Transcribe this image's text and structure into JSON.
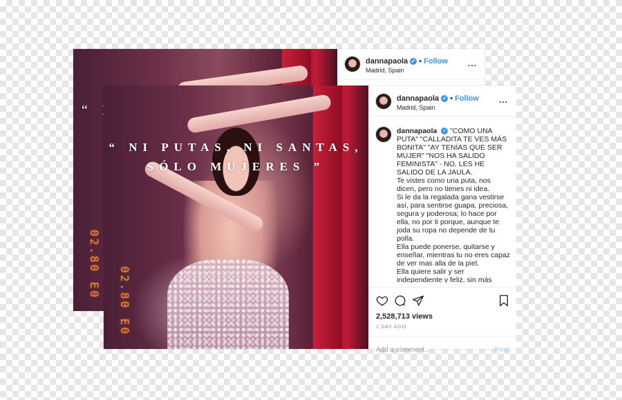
{
  "back_post": {
    "username": "dannapaola",
    "follow_label": "Follow",
    "separator": "•",
    "location": "Madrid, Spain",
    "more_label": "...",
    "overlay_quote_visible": "“ N",
    "datestamp": "02.80 E0"
  },
  "front_post": {
    "username": "dannapaola",
    "follow_label": "Follow",
    "separator": "•",
    "location": "Madrid, Spain",
    "more_label": "...",
    "overlay_quote_line1": "“ NI PUTAS, NI SANTAS,",
    "overlay_quote_line2": "SÓLO MUJERES ”",
    "datestamp": "02.80 E0",
    "caption_username": "dannapaola",
    "caption_lines": [
      "\"COMO UNA PUTA\" \"CALLADITA TE VES MÁS BONITA\" \"AY TENÍAS QUE SER MUJER\" \"NOS HA SALIDO FEMINISTA\" - NO, LES HE SALIDO DE LA JAULA.",
      "Te vistes como una puta, nos dicen, pero no tienes ni idea.",
      "Si le da la regalada gana vestirse así, para sentirse guapa, preciosa, segura y poderosa; lo hace por ella, no por ti porque, aunque te joda su ropa no depende de tu polla.",
      "Ella puede ponerse, quitarse y enseñar, mientras tu no eres capaz de ver mas alla de la piel.",
      "Ella quiere salir y ser independiente y feliz, sin más miedos, Ella puede conducir el auto que le de la gana, cargar toneladas, jugar fútbol, emprender, correr mil kilometros"
    ],
    "views": "2,528,713 views",
    "time_ago": "1 DAY AGO",
    "comment_placeholder": "Add a comment…",
    "post_label": "Post"
  },
  "colors": {
    "link_blue": "#3897f0",
    "datestamp_orange": "#f08a2a",
    "post_disabled": "#b2dffc"
  }
}
